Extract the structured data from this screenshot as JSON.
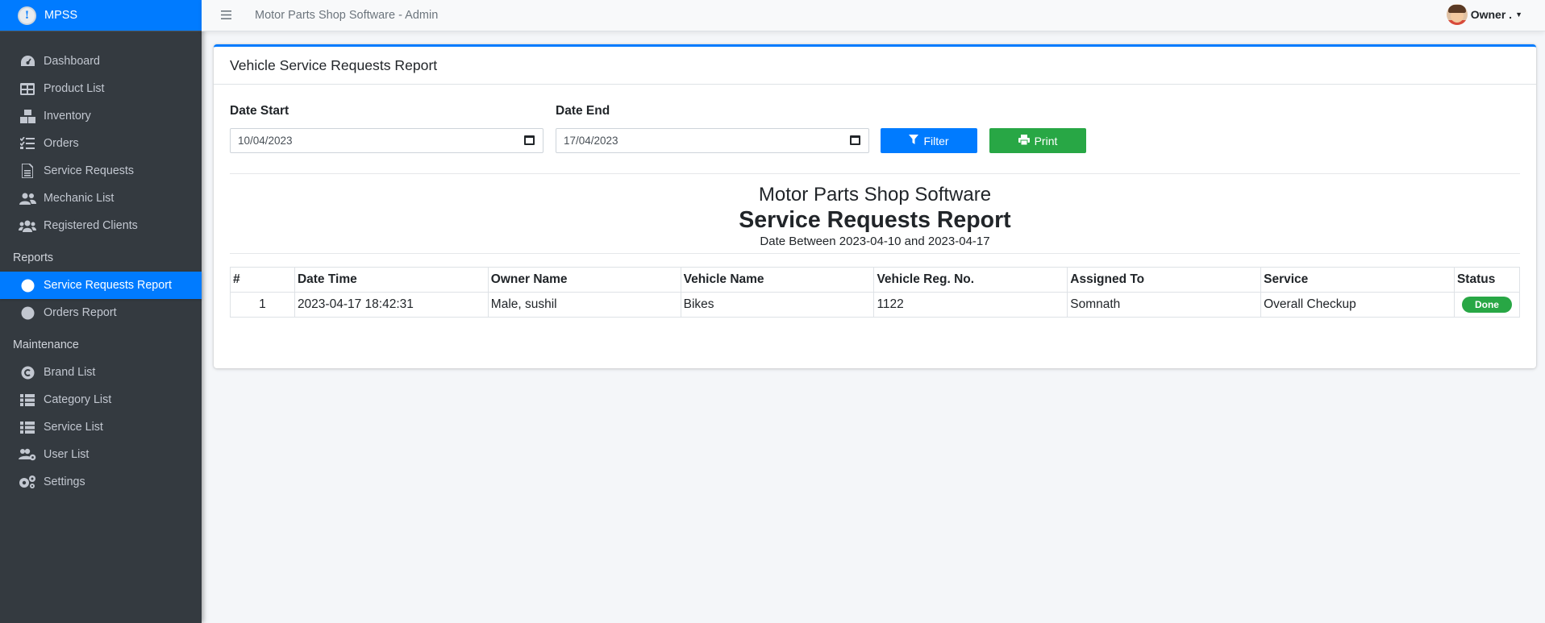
{
  "brand": {
    "logo_glyph": "!",
    "name": "MPSS"
  },
  "topbar": {
    "menu_icon": "hamburger-icon",
    "app_title": "Motor Parts Shop Software - Admin",
    "user_name": "Owner ."
  },
  "sidebar": {
    "items": [
      {
        "label": "Dashboard",
        "icon": "tachometer-icon"
      },
      {
        "label": "Product List",
        "icon": "table-icon"
      },
      {
        "label": "Inventory",
        "icon": "boxes-icon"
      },
      {
        "label": "Orders",
        "icon": "list-check-icon"
      },
      {
        "label": "Service Requests",
        "icon": "file-icon"
      },
      {
        "label": "Mechanic List",
        "icon": "users-icon"
      },
      {
        "label": "Registered Clients",
        "icon": "users-group-icon"
      }
    ],
    "reports_header": "Reports",
    "reports": [
      {
        "label": "Service Requests Report",
        "icon": "circle-icon",
        "active": true
      },
      {
        "label": "Orders Report",
        "icon": "circle-icon",
        "active": false
      }
    ],
    "maintenance_header": "Maintenance",
    "maintenance": [
      {
        "label": "Brand List",
        "icon": "copyright-icon"
      },
      {
        "label": "Category List",
        "icon": "th-list-icon"
      },
      {
        "label": "Service List",
        "icon": "th-list-icon"
      },
      {
        "label": "User List",
        "icon": "users-cog-icon"
      },
      {
        "label": "Settings",
        "icon": "cogs-icon"
      }
    ]
  },
  "card": {
    "title": "Vehicle Service Requests Report",
    "date_start_label": "Date Start",
    "date_start_value": "10/04/2023",
    "date_end_label": "Date End",
    "date_end_value": "17/04/2023",
    "filter_label": "Filter",
    "print_label": "Print"
  },
  "report": {
    "company": "Motor Parts Shop Software",
    "title": "Service Requests Report",
    "range": "Date Between 2023-04-10 and 2023-04-17",
    "columns": [
      "#",
      "Date Time",
      "Owner Name",
      "Vehicle Name",
      "Vehicle Reg. No.",
      "Assigned To",
      "Service",
      "Status"
    ],
    "rows": [
      {
        "num": "1",
        "datetime": "2023-04-17 18:42:31",
        "owner": "Male, sushil",
        "vehicle": "Bikes",
        "reg_no": "1122",
        "assigned": "Somnath",
        "service": "Overall Checkup",
        "status": "Done"
      }
    ]
  },
  "colors": {
    "primary": "#007bff",
    "success": "#28a745",
    "sidebar": "#343a40"
  }
}
